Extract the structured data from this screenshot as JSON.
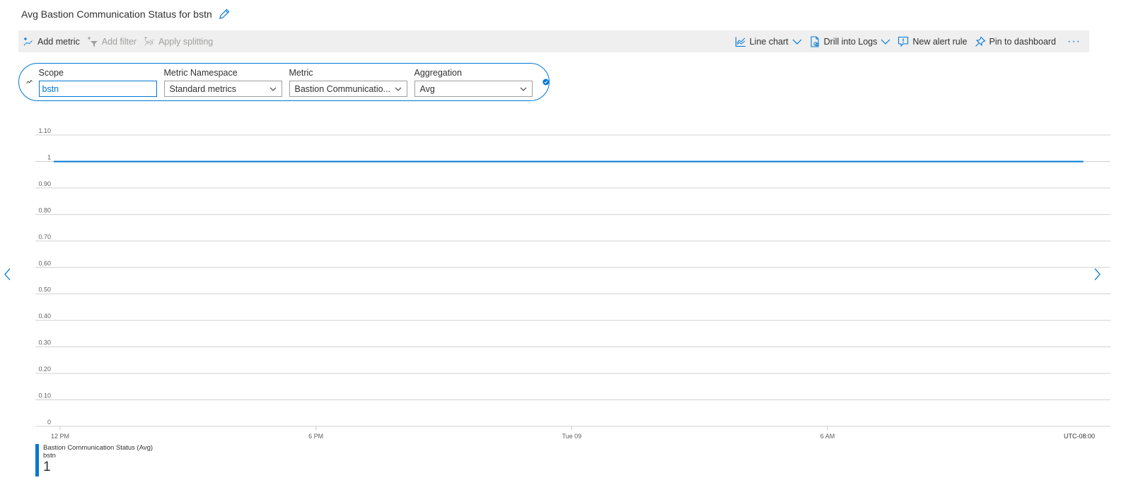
{
  "header": {
    "title": "Avg Bastion Communication Status for bstn",
    "edit_icon": "pencil-icon"
  },
  "toolbar": {
    "left": [
      {
        "label": "Add metric",
        "icon": "add-metric-icon",
        "enabled": true
      },
      {
        "label": "Add filter",
        "icon": "add-filter-icon",
        "enabled": false
      },
      {
        "label": "Apply splitting",
        "icon": "apply-splitting-icon",
        "enabled": false
      }
    ],
    "right": [
      {
        "label": "Line chart",
        "icon": "line-chart-icon",
        "dropdown": true
      },
      {
        "label": "Drill into Logs",
        "icon": "logs-icon",
        "dropdown": true
      },
      {
        "label": "New alert rule",
        "icon": "alert-icon",
        "dropdown": false
      },
      {
        "label": "Pin to dashboard",
        "icon": "pin-icon",
        "dropdown": false
      }
    ],
    "more_label": "···"
  },
  "metric_selector": {
    "scope": {
      "label": "Scope",
      "value": "bstn"
    },
    "namespace": {
      "label": "Metric Namespace",
      "value": "Standard metrics"
    },
    "metric": {
      "label": "Metric",
      "value": "Bastion Communicatio..."
    },
    "aggregation": {
      "label": "Aggregation",
      "value": "Avg"
    }
  },
  "accent_color": "#0078d4",
  "chart_data": {
    "type": "line",
    "title": "Avg Bastion Communication Status for bstn",
    "xlabel": "",
    "ylabel": "",
    "ylim": [
      0,
      1.1
    ],
    "yticks": [
      "0",
      "0.10",
      "0.20",
      "0.30",
      "0.40",
      "0.50",
      "0.60",
      "0.70",
      "0.80",
      "0.90",
      "1",
      "1.10"
    ],
    "ytick_values": [
      0,
      0.1,
      0.2,
      0.3,
      0.4,
      0.5,
      0.6,
      0.7,
      0.8,
      0.9,
      1.0,
      1.1
    ],
    "xticks": [
      "12 PM",
      "6 PM",
      "Tue 09",
      "6 AM"
    ],
    "xtick_hours": [
      0,
      6,
      12,
      18
    ],
    "xlim_hours": [
      -0.15,
      24.3
    ],
    "timezone_label": "UTC-08:00",
    "grid": true,
    "series": [
      {
        "name": "Bastion Communication Status (Avg)",
        "resource": "bstn",
        "color": "#0078d4",
        "x_hours": [
          -0.15,
          24.0
        ],
        "values": [
          1,
          1
        ]
      }
    ],
    "legend": {
      "placement": "bottom-left",
      "name": "Bastion Communication Status (Avg)",
      "resource": "bstn",
      "summary_value": "1"
    }
  }
}
